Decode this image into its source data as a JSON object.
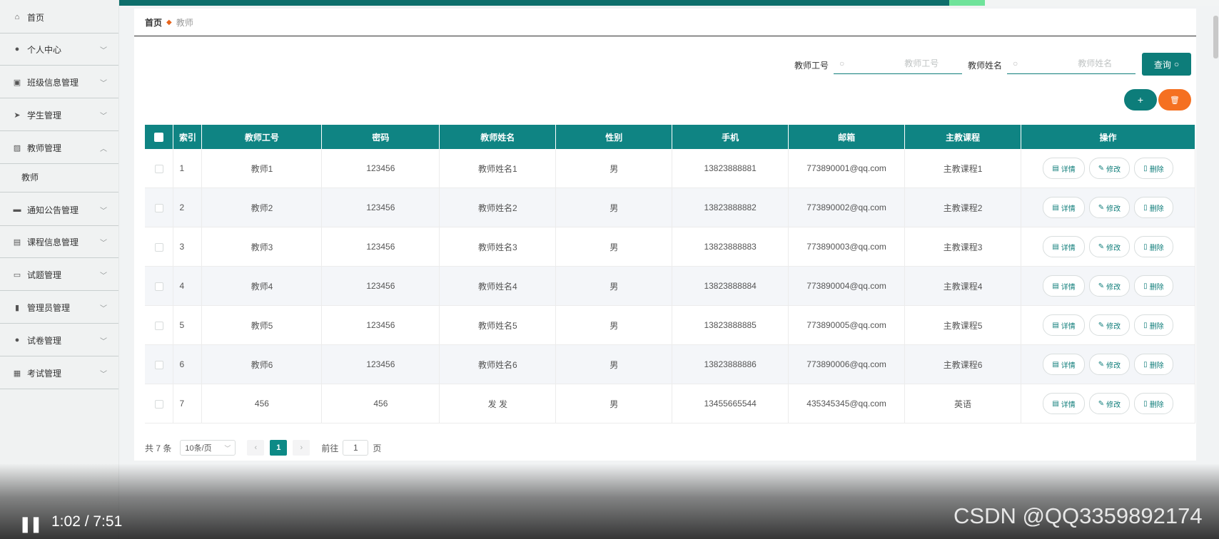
{
  "colors": {
    "brand": "#0f8483",
    "danger": "#f57021",
    "top": "#0d6e6b"
  },
  "sidebar": {
    "items": [
      {
        "label": "首页",
        "icon": "home-icon"
      },
      {
        "label": "个人中心",
        "icon": "user-icon"
      },
      {
        "label": "班级信息管理",
        "icon": "clipboard-icon"
      },
      {
        "label": "学生管理",
        "icon": "send-icon"
      },
      {
        "label": "教师管理",
        "icon": "chart-icon"
      },
      {
        "label": "教师",
        "icon": ""
      },
      {
        "label": "通知公告管理",
        "icon": "message-icon"
      },
      {
        "label": "课程信息管理",
        "icon": "briefcase-icon"
      },
      {
        "label": "试题管理",
        "icon": "comment-icon"
      },
      {
        "label": "管理员管理",
        "icon": "bar-chart-icon"
      },
      {
        "label": "试卷管理",
        "icon": "user-icon"
      },
      {
        "label": "考试管理",
        "icon": "document-icon"
      }
    ]
  },
  "breadcrumb": {
    "home": "首页",
    "current": "教师"
  },
  "search": {
    "id_label": "教师工号",
    "id_placeholder": "教师工号",
    "name_label": "教师姓名",
    "name_placeholder": "教师姓名",
    "query_label": "查询"
  },
  "actions": {
    "add": "+",
    "delete": "🗑"
  },
  "table": {
    "headers": [
      "索引",
      "教师工号",
      "密码",
      "教师姓名",
      "性别",
      "手机",
      "邮箱",
      "主教课程",
      "操作"
    ],
    "rows": [
      {
        "index": "1",
        "id": "教师1",
        "password": "123456",
        "name": "教师姓名1",
        "gender": "男",
        "phone": "13823888881",
        "email": "773890001@qq.com",
        "course": "主教课程1"
      },
      {
        "index": "2",
        "id": "教师2",
        "password": "123456",
        "name": "教师姓名2",
        "gender": "男",
        "phone": "13823888882",
        "email": "773890002@qq.com",
        "course": "主教课程2"
      },
      {
        "index": "3",
        "id": "教师3",
        "password": "123456",
        "name": "教师姓名3",
        "gender": "男",
        "phone": "13823888883",
        "email": "773890003@qq.com",
        "course": "主教课程3"
      },
      {
        "index": "4",
        "id": "教师4",
        "password": "123456",
        "name": "教师姓名4",
        "gender": "男",
        "phone": "13823888884",
        "email": "773890004@qq.com",
        "course": "主教课程4"
      },
      {
        "index": "5",
        "id": "教师5",
        "password": "123456",
        "name": "教师姓名5",
        "gender": "男",
        "phone": "13823888885",
        "email": "773890005@qq.com",
        "course": "主教课程5"
      },
      {
        "index": "6",
        "id": "教师6",
        "password": "123456",
        "name": "教师姓名6",
        "gender": "男",
        "phone": "13823888886",
        "email": "773890006@qq.com",
        "course": "主教课程6"
      },
      {
        "index": "7",
        "id": "456",
        "password": "456",
        "name": "发 发",
        "gender": "男",
        "phone": "13455665544",
        "email": "435345345@qq.com",
        "course": "英语"
      }
    ],
    "ops": {
      "detail": "详情",
      "edit": "修改",
      "delete": "删除"
    }
  },
  "pager": {
    "total": "共 7 条",
    "size": "10条/页",
    "current": "1",
    "goto_prefix": "前往",
    "goto_value": "1",
    "goto_suffix": "页"
  },
  "video": {
    "time": "1:02 / 7:51",
    "watermark": "CSDN @QQ3359892174"
  }
}
